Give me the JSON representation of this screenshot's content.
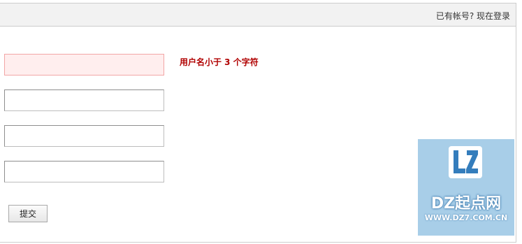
{
  "header": {
    "login_prompt": "已有帐号? 现在登录"
  },
  "form": {
    "fields": [
      {
        "value": "",
        "placeholder": ""
      },
      {
        "value": "",
        "placeholder": ""
      },
      {
        "value": "",
        "placeholder": ""
      },
      {
        "value": "",
        "placeholder": ""
      }
    ],
    "error_message": "用户名小于 3 个字符",
    "submit_label": "提交"
  },
  "watermark": {
    "logo_text": "LZ",
    "name": "DZ起点网",
    "url": "WWW.DZ7.COM.CN"
  },
  "colors": {
    "error_text": "#b00000",
    "error_field_bg": "#ffeeee",
    "watermark_bg": "#9fc9e6",
    "watermark_accent": "#1f6fb5"
  }
}
